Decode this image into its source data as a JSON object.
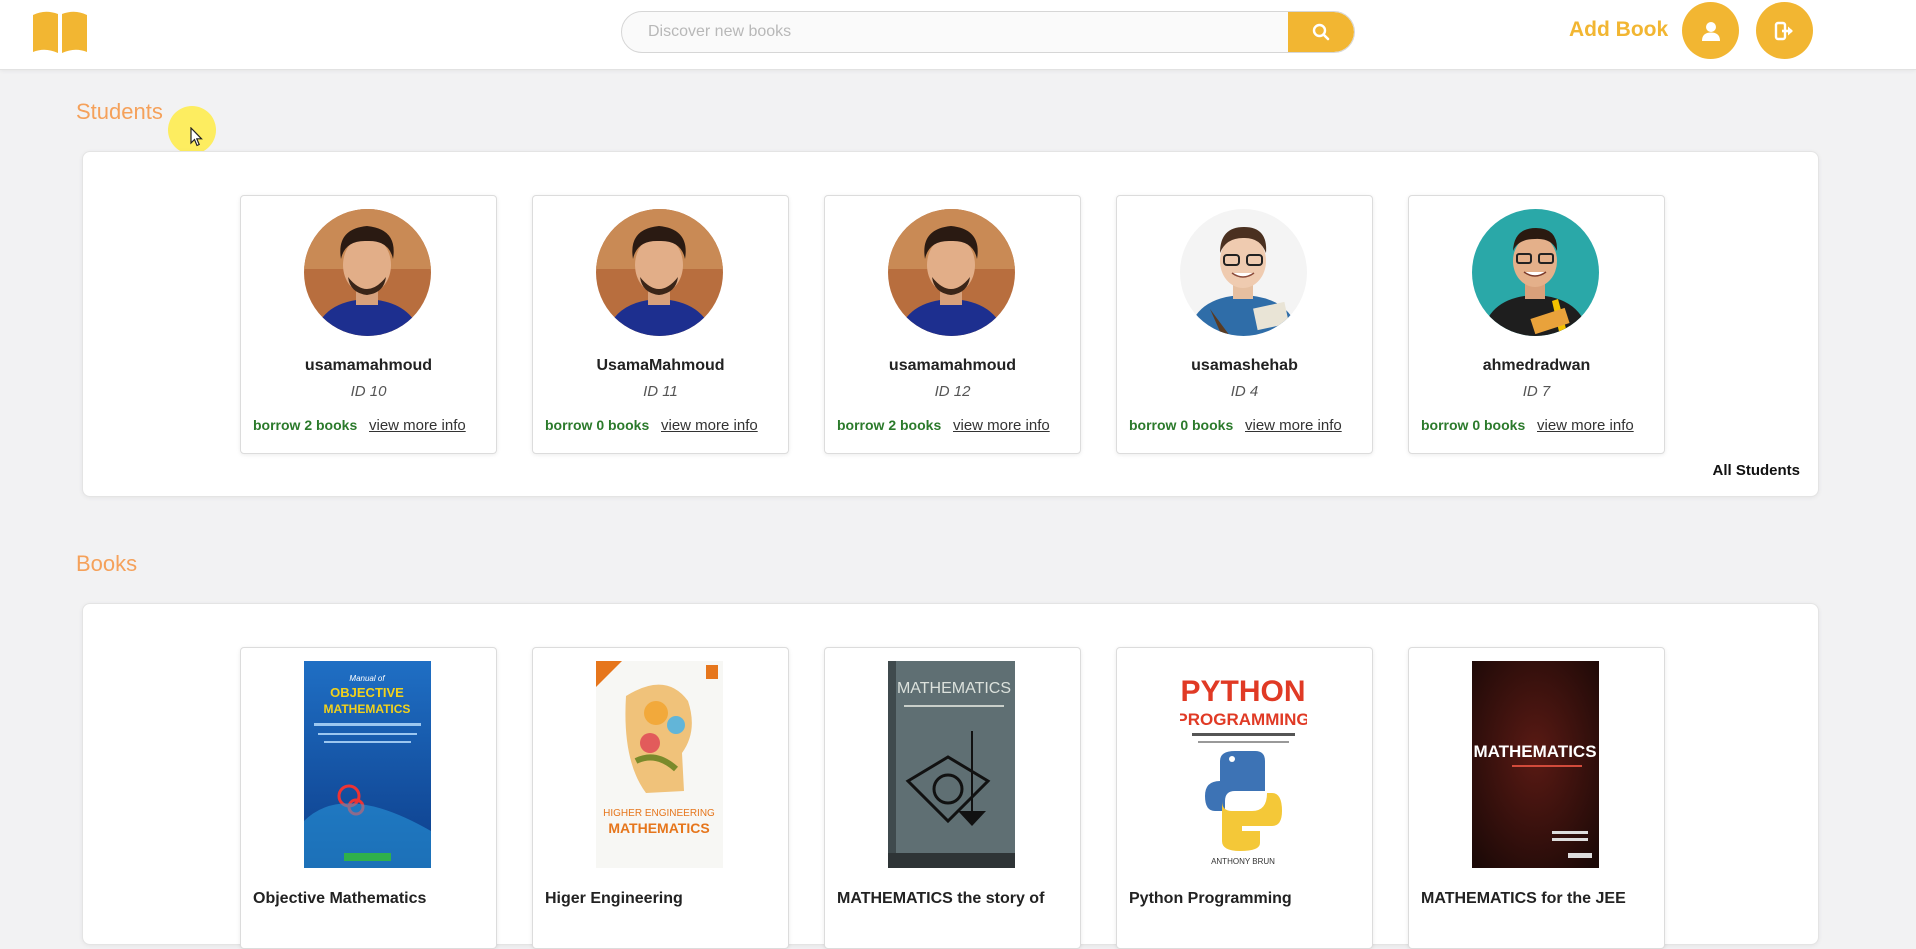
{
  "header": {
    "search_placeholder": "Discover new books",
    "add_book_label": "Add Book"
  },
  "students": {
    "title": "Students",
    "all_label": "All Students",
    "items": [
      {
        "name": "usamamahmoud",
        "id": "ID 10",
        "borrow": "borrow 2 books",
        "link": "view more info",
        "avatar": "man-curly-hair"
      },
      {
        "name": "UsamaMahmoud",
        "id": "ID 11",
        "borrow": "borrow 0 books",
        "link": "view more info",
        "avatar": "man-curly-hair"
      },
      {
        "name": "usamamahmoud",
        "id": "ID 12",
        "borrow": "borrow 2 books",
        "link": "view more info",
        "avatar": "man-curly-hair"
      },
      {
        "name": "usamashehab",
        "id": "ID 4",
        "borrow": "borrow 0 books",
        "link": "view more info",
        "avatar": "student-glasses"
      },
      {
        "name": "ahmedradwan",
        "id": "ID 7",
        "borrow": "borrow 0 books",
        "link": "view more info",
        "avatar": "student-teal-background"
      }
    ]
  },
  "books": {
    "title": "Books",
    "items": [
      {
        "title": "Objective Mathematics",
        "cover_lines": [
          "Manual of",
          "OBJECTIVE",
          "MATHEMATICS"
        ]
      },
      {
        "title": "Higer Engineering",
        "cover_lines": [
          "HIGHER ENGINEERING",
          "MATHEMATICS"
        ]
      },
      {
        "title": "MATHEMATICS the story of",
        "cover_lines": [
          "MATHEMATICS"
        ]
      },
      {
        "title": "Python Programming",
        "cover_lines": [
          "PYTHON",
          "PROGRAMMING",
          "ANTHONY BRUN"
        ]
      },
      {
        "title": "MATHEMATICS for the JEE",
        "cover_lines": [
          "MATHEMATICS"
        ]
      }
    ]
  },
  "colors": {
    "accent": "#f2b632",
    "section_title": "#f5a15a",
    "borrow_text": "#2b7a2b"
  }
}
